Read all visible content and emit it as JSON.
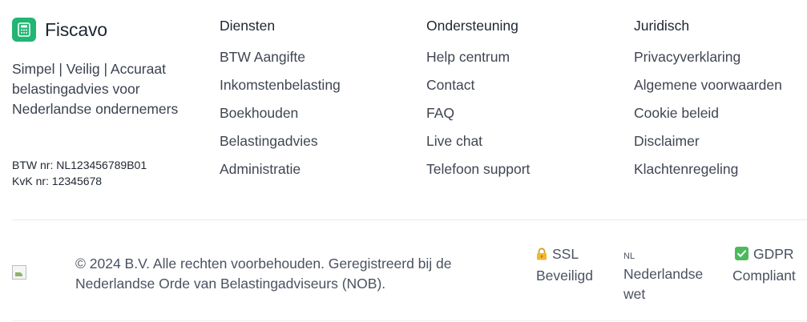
{
  "brand": {
    "name": "Fiscavo",
    "tagline": "Simpel | Veilig | Accuraat belastingadvies voor Nederlandse ondernemers",
    "btw": "BTW nr: NL123456789B01",
    "kvk": "KvK nr: 12345678",
    "logo_icon": "calculator-icon",
    "accent": "#22b573"
  },
  "columns": [
    {
      "title": "Diensten",
      "links": [
        "BTW Aangifte",
        "Inkomstenbelasting",
        "Boekhouden",
        "Belastingadvies",
        "Administratie"
      ]
    },
    {
      "title": "Ondersteuning",
      "links": [
        "Help centrum",
        "Contact",
        "FAQ",
        "Live chat",
        "Telefoon support"
      ]
    },
    {
      "title": "Juridisch",
      "links": [
        "Privacyverklaring",
        "Algemene voorwaarden",
        "Cookie beleid",
        "Disclaimer",
        "Klachtenregeling"
      ]
    }
  ],
  "bottom": {
    "copyright": "© 2024 B.V. Alle rechten voorbehouden. Geregistreerd bij de Nederlandse Orde van Belastingadviseurs (NOB).",
    "badges": {
      "ssl": {
        "icon": "lock-icon",
        "line1": "SSL",
        "line2": "Beveiligd"
      },
      "nl": {
        "code": "NL",
        "line1": "Nederlandse",
        "line2": "wet"
      },
      "gdpr": {
        "icon": "check-icon",
        "line1": "GDPR",
        "line2": "Compliant"
      }
    }
  }
}
